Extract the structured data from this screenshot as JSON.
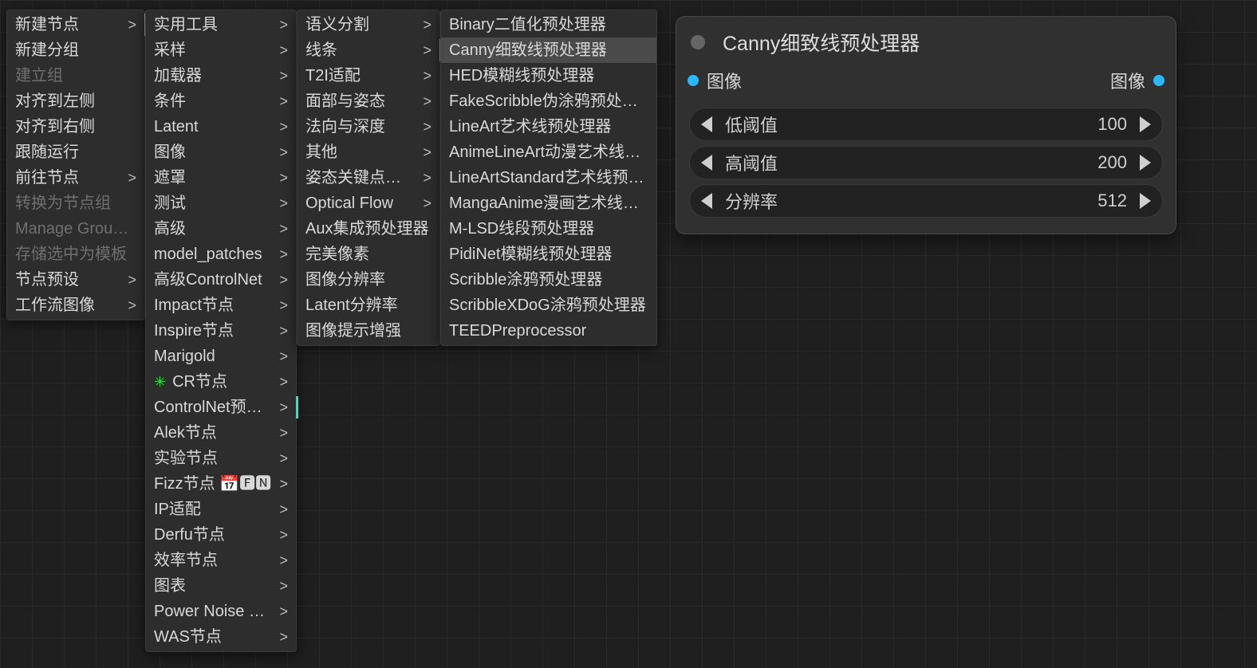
{
  "node": {
    "title": "Canny细致线预处理器",
    "input_label": "图像",
    "output_label": "图像",
    "widgets": [
      {
        "label": "低阈值",
        "value": "100"
      },
      {
        "label": "高阈值",
        "value": "200"
      },
      {
        "label": "分辨率",
        "value": "512"
      }
    ]
  },
  "menus": {
    "col0": [
      {
        "label": "新建节点",
        "submenu": true,
        "active": true
      },
      {
        "label": "新建分组"
      },
      {
        "label": "建立组",
        "disabled": true
      },
      {
        "label": "对齐到左侧"
      },
      {
        "label": "对齐到右侧"
      },
      {
        "label": "跟随运行"
      },
      {
        "label": "前往节点",
        "submenu": true
      },
      {
        "label": "转换为节点组",
        "disabled": true
      },
      {
        "label": "Manage Group Nodes",
        "disabled": true
      },
      {
        "label": "存储选中为模板",
        "disabled": true
      },
      {
        "label": "节点预设",
        "submenu": true
      },
      {
        "label": "工作流图像",
        "submenu": true
      }
    ],
    "col1": [
      {
        "label": "实用工具",
        "submenu": true
      },
      {
        "label": "采样",
        "submenu": true
      },
      {
        "label": "加载器",
        "submenu": true
      },
      {
        "label": "条件",
        "submenu": true
      },
      {
        "label": "Latent",
        "submenu": true
      },
      {
        "label": "图像",
        "submenu": true
      },
      {
        "label": "遮罩",
        "submenu": true
      },
      {
        "label": "测试",
        "submenu": true
      },
      {
        "label": "高级",
        "submenu": true
      },
      {
        "label": "model_patches",
        "submenu": true
      },
      {
        "label": "高级ControlNet",
        "submenu": true
      },
      {
        "label": "Impact节点",
        "submenu": true
      },
      {
        "label": "Inspire节点",
        "submenu": true
      },
      {
        "label": "Marigold",
        "submenu": true
      },
      {
        "label": "CR节点",
        "submenu": true,
        "prefix_icon": "✳",
        "prefix_color": "green"
      },
      {
        "label": "ControlNet预处理器",
        "submenu": true,
        "active": true
      },
      {
        "label": "Alek节点",
        "submenu": true
      },
      {
        "label": "实验节点",
        "submenu": true
      },
      {
        "label": "Fizz节点 📅🅵🅽",
        "submenu": true
      },
      {
        "label": "IP适配",
        "submenu": true
      },
      {
        "label": "Derfu节点",
        "submenu": true
      },
      {
        "label": "效率节点",
        "submenu": true
      },
      {
        "label": "图表",
        "submenu": true
      },
      {
        "label": "Power Noise Suite",
        "submenu": true
      },
      {
        "label": "WAS节点",
        "submenu": true
      }
    ],
    "col2": [
      {
        "label": "语义分割",
        "submenu": true
      },
      {
        "label": "线条",
        "submenu": true,
        "active": true
      },
      {
        "label": "T2I适配",
        "submenu": true
      },
      {
        "label": "面部与姿态",
        "submenu": true
      },
      {
        "label": "法向与深度",
        "submenu": true
      },
      {
        "label": "其他",
        "submenu": true
      },
      {
        "label": "姿态关键点后处理",
        "submenu": true
      },
      {
        "label": "Optical Flow",
        "submenu": true
      },
      {
        "label": "Aux集成预处理器"
      },
      {
        "label": "完美像素"
      },
      {
        "label": "图像分辨率"
      },
      {
        "label": "Latent分辨率"
      },
      {
        "label": "图像提示增强"
      }
    ],
    "col3": [
      {
        "label": "Binary二值化预处理器"
      },
      {
        "label": "Canny细致线预处理器",
        "hover": true
      },
      {
        "label": "HED模糊线预处理器"
      },
      {
        "label": "FakeScribble伪涂鸦预处理器"
      },
      {
        "label": "LineArt艺术线预处理器"
      },
      {
        "label": "AnimeLineArt动漫艺术线预处理器"
      },
      {
        "label": "LineArtStandard艺术线预处理器"
      },
      {
        "label": "MangaAnime漫画艺术线预处理器"
      },
      {
        "label": "M-LSD线段预处理器"
      },
      {
        "label": "PidiNet模糊线预处理器"
      },
      {
        "label": "Scribble涂鸦预处理器"
      },
      {
        "label": "ScribbleXDoG涂鸦预处理器"
      },
      {
        "label": "TEEDPreprocessor"
      }
    ]
  }
}
